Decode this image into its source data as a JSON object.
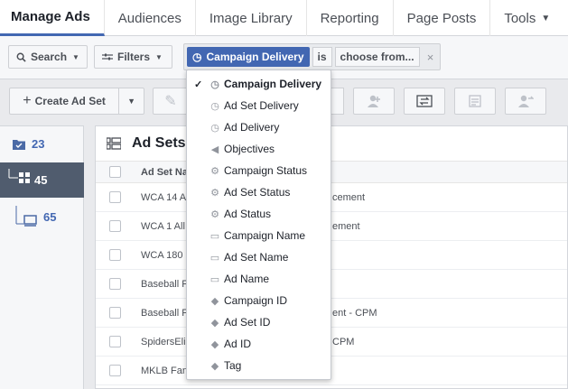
{
  "nav": {
    "tabs": [
      {
        "label": "Manage Ads",
        "active": true
      },
      {
        "label": "Audiences"
      },
      {
        "label": "Image Library"
      },
      {
        "label": "Reporting"
      },
      {
        "label": "Page Posts"
      },
      {
        "label": "Tools"
      }
    ]
  },
  "filterbar": {
    "search_label": "Search",
    "filters_label": "Filters",
    "chip": {
      "field": "Campaign Delivery",
      "operator": "is",
      "value": "choose from...",
      "close": "×"
    }
  },
  "toolbar": {
    "create_label": "Create Ad Set",
    "plus": "+",
    "icons": [
      "pencil-icon",
      "add-user-icon",
      "swap-icon",
      "report-icon",
      "share-user-icon"
    ]
  },
  "sidebar": {
    "items": [
      {
        "count": "23",
        "icon": "campaign-folder-icon"
      },
      {
        "count": "45",
        "icon": "ad-set-grid-icon",
        "selected": true
      },
      {
        "count": "65",
        "icon": "ad-monitor-icon"
      }
    ]
  },
  "table": {
    "title": "Ad Sets",
    "column_header": "Ad Set Na",
    "rows": [
      {
        "name": "WCA 14 A",
        "suffix": "cement"
      },
      {
        "name": "WCA 1 All",
        "suffix": "ement"
      },
      {
        "name": "WCA 180",
        "suffix": ""
      },
      {
        "name": "Baseball F",
        "suffix": ""
      },
      {
        "name": "Baseball F",
        "suffix": "ent - CPM"
      },
      {
        "name": "SpidersEli",
        "suffix": "CPM"
      },
      {
        "name": "MKLB Fan",
        "suffix": ""
      }
    ]
  },
  "dropdown": {
    "check": "✓",
    "items": [
      {
        "label": "Campaign Delivery",
        "icon": "clock-icon",
        "glyph": "◷",
        "selected": true
      },
      {
        "label": "Ad Set Delivery",
        "icon": "clock-icon",
        "glyph": "◷"
      },
      {
        "label": "Ad Delivery",
        "icon": "clock-icon",
        "glyph": "◷"
      },
      {
        "label": "Objectives",
        "icon": "megaphone-icon",
        "glyph": "◀"
      },
      {
        "label": "Campaign Status",
        "icon": "gear-icon",
        "glyph": "⚙"
      },
      {
        "label": "Ad Set Status",
        "icon": "gear-icon",
        "glyph": "⚙"
      },
      {
        "label": "Ad Status",
        "icon": "gear-icon",
        "glyph": "⚙"
      },
      {
        "label": "Campaign Name",
        "icon": "book-icon",
        "glyph": "▭"
      },
      {
        "label": "Ad Set Name",
        "icon": "book-icon",
        "glyph": "▭"
      },
      {
        "label": "Ad Name",
        "icon": "book-icon",
        "glyph": "▭"
      },
      {
        "label": "Campaign ID",
        "icon": "tag-icon",
        "glyph": "◆"
      },
      {
        "label": "Ad Set ID",
        "icon": "tag-icon",
        "glyph": "◆"
      },
      {
        "label": "Ad ID",
        "icon": "tag-icon",
        "glyph": "◆"
      },
      {
        "label": "Tag",
        "icon": "tag-icon",
        "glyph": "◆"
      }
    ]
  }
}
